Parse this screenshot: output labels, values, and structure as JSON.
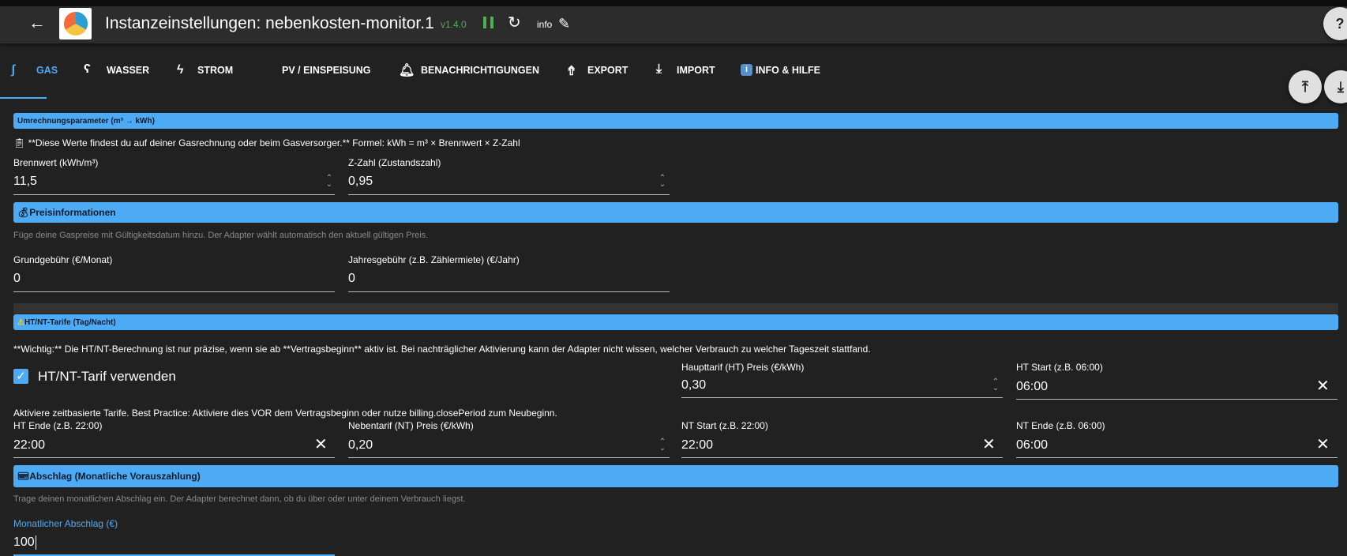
{
  "header": {
    "title": "Instanzeinstellungen: nebenkosten-monitor.1",
    "version": "v1.4.0",
    "info_label": "info"
  },
  "tabs": [
    {
      "label": "GAS",
      "icon": "gas-flame-icon",
      "active": true
    },
    {
      "label": "WASSER",
      "icon": "water-tap-icon"
    },
    {
      "label": "STROM",
      "icon": "lightning-icon"
    },
    {
      "label": "PV / EINSPEISUNG"
    },
    {
      "label": "BENACHRICHTIGUNGEN",
      "icon": "bell-icon"
    },
    {
      "label": "EXPORT",
      "icon": "upload-icon"
    },
    {
      "label": "IMPORT",
      "icon": "download-icon"
    },
    {
      "label": "INFO & HILFE",
      "icon": "info-icon"
    }
  ],
  "sections": {
    "umrechnung": {
      "title": "Umrechnungsparameter (m³ → kWh)",
      "note": "**Diese Werte findest du auf deiner Gasrechnung oder beim Gasversorger.** Formel: kWh = m³ × Brennwert × Z-Zahl",
      "brennwert": {
        "label": "Brennwert (kWh/m³)",
        "value": "11,5"
      },
      "zzahl": {
        "label": "Z-Zahl (Zustandszahl)",
        "value": "0,95"
      }
    },
    "preis": {
      "title": "Preisinformationen",
      "note": "Füge deine Gaspreise mit Gültigkeitsdatum hinzu. Der Adapter wählt automatisch den aktuell gültigen Preis.",
      "grund": {
        "label": "Grundgebühr (€/Monat)",
        "value": "0"
      },
      "jahr": {
        "label": "Jahresgebühr (z.B. Zählermiete) (€/Jahr)",
        "value": "0"
      }
    },
    "htnt": {
      "title": "HT/NT-Tarife (Tag/Nacht)",
      "note": "**Wichtig:** Die HT/NT-Berechnung ist nur präzise, wenn sie ab **Vertragsbeginn** aktiv ist. Bei nachträglicher Aktivierung kann der Adapter nicht wissen, welcher Verbrauch zu welcher Tageszeit stattfand.",
      "checkbox_label": "HT/NT-Tarif verwenden",
      "checked": true,
      "checkbox_help": "Aktiviere zeitbasierte Tarife. Best Practice: Aktiviere dies VOR dem Vertragsbeginn oder nutze billing.closePeriod zum Neubeginn.",
      "ht_price": {
        "label": "Haupttarif (HT) Preis (€/kWh)",
        "value": "0,30"
      },
      "ht_start": {
        "label": "HT Start (z.B. 06:00)",
        "value": "06:00"
      },
      "ht_end": {
        "label": "HT Ende (z.B. 22:00)",
        "value": "22:00"
      },
      "nt_price": {
        "label": "Nebentarif (NT) Preis (€/kWh)",
        "value": "0,20"
      },
      "nt_start": {
        "label": "NT Start (z.B. 22:00)",
        "value": "22:00"
      },
      "nt_end": {
        "label": "NT Ende (z.B. 06:00)",
        "value": "06:00"
      }
    },
    "abschlag": {
      "title": "Abschlag (Monatliche Vorauszahlung)",
      "note": "Trage deinen monatlichen Abschlag ein. Der Adapter berechnet dann, ob du über oder unter deinem Verbrauch liegst.",
      "monthly": {
        "label": "Monatlicher Abschlag (€)",
        "value": "100"
      }
    }
  },
  "colors": {
    "accent": "#4dabf5",
    "background": "#212121",
    "header": "#2c2c2c",
    "version": "#4caf50"
  }
}
